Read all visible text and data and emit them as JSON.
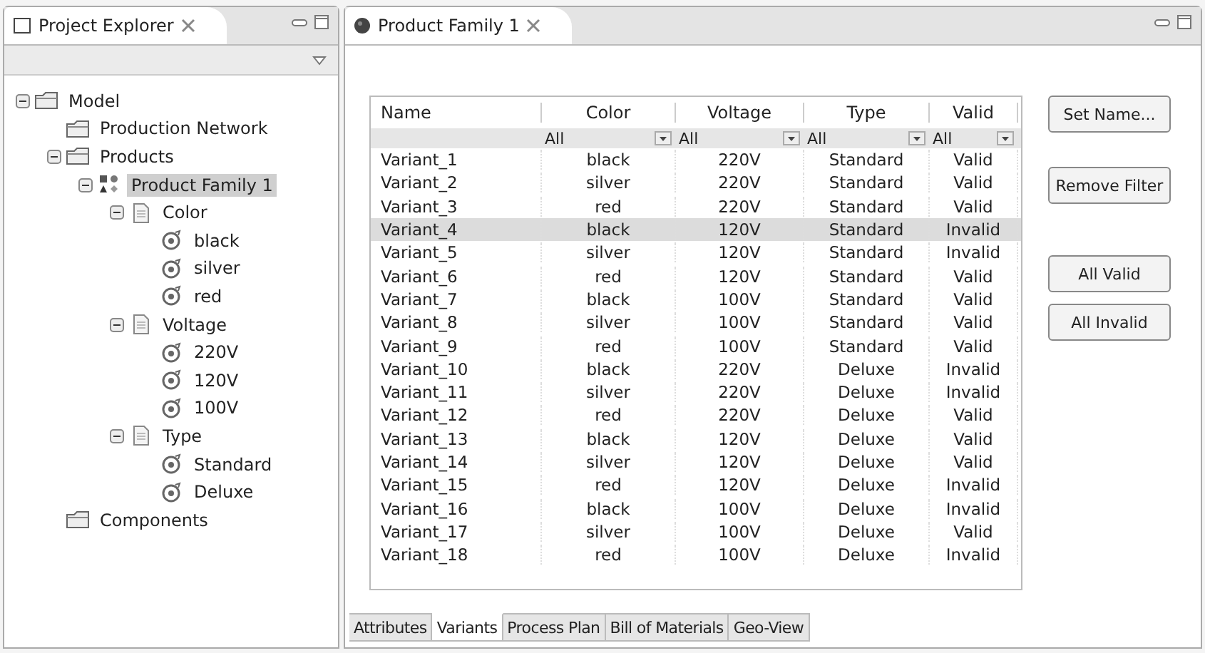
{
  "explorer": {
    "title": "Project Explorer",
    "tree": [
      {
        "label": "Model",
        "kind": "folder",
        "expanded": true,
        "selected": false,
        "children": [
          {
            "label": "Production Network",
            "kind": "folder",
            "selected": false
          },
          {
            "label": "Products",
            "kind": "folder",
            "expanded": true,
            "selected": false,
            "children": [
              {
                "label": "Product Family 1",
                "kind": "family",
                "expanded": true,
                "selected": true,
                "children": [
                  {
                    "label": "Color",
                    "kind": "feature",
                    "expanded": true,
                    "selected": false,
                    "children": [
                      {
                        "label": "black",
                        "kind": "option",
                        "selected": false
                      },
                      {
                        "label": "silver",
                        "kind": "option",
                        "selected": false
                      },
                      {
                        "label": "red",
                        "kind": "option",
                        "selected": false
                      }
                    ]
                  },
                  {
                    "label": "Voltage",
                    "kind": "feature",
                    "expanded": true,
                    "selected": false,
                    "children": [
                      {
                        "label": "220V",
                        "kind": "option",
                        "selected": false
                      },
                      {
                        "label": "120V",
                        "kind": "option",
                        "selected": false
                      },
                      {
                        "label": "100V",
                        "kind": "option",
                        "selected": false
                      }
                    ]
                  },
                  {
                    "label": "Type",
                    "kind": "feature",
                    "expanded": true,
                    "selected": false,
                    "children": [
                      {
                        "label": "Standard",
                        "kind": "option",
                        "selected": false
                      },
                      {
                        "label": "Deluxe",
                        "kind": "option",
                        "selected": false
                      }
                    ]
                  }
                ]
              }
            ]
          },
          {
            "label": "Components",
            "kind": "folder",
            "selected": false
          }
        ]
      }
    ]
  },
  "editor": {
    "title": "Product Family 1",
    "table": {
      "columns": [
        "Name",
        "Color",
        "Voltage",
        "Type",
        "Valid"
      ],
      "filters": [
        "All",
        "All",
        "All",
        "All"
      ],
      "rows": [
        {
          "cells": [
            "Variant_1",
            "black",
            "220V",
            "Standard",
            "Valid"
          ],
          "selected": false
        },
        {
          "cells": [
            "Variant_2",
            "silver",
            "220V",
            "Standard",
            "Valid"
          ],
          "selected": false
        },
        {
          "cells": [
            "Variant_3",
            "red",
            "220V",
            "Standard",
            "Valid"
          ],
          "selected": false
        },
        {
          "cells": [
            "Variant_4",
            "black",
            "120V",
            "Standard",
            "Invalid"
          ],
          "selected": true
        },
        {
          "cells": [
            "Variant_5",
            "silver",
            "120V",
            "Standard",
            "Invalid"
          ],
          "selected": false
        },
        {
          "cells": [
            "Variant_6",
            "red",
            "120V",
            "Standard",
            "Valid"
          ],
          "selected": false
        },
        {
          "cells": [
            "Variant_7",
            "black",
            "100V",
            "Standard",
            "Valid"
          ],
          "selected": false
        },
        {
          "cells": [
            "Variant_8",
            "silver",
            "100V",
            "Standard",
            "Valid"
          ],
          "selected": false
        },
        {
          "cells": [
            "Variant_9",
            "red",
            "100V",
            "Standard",
            "Valid"
          ],
          "selected": false
        },
        {
          "cells": [
            "Variant_10",
            "black",
            "220V",
            "Deluxe",
            "Invalid"
          ],
          "selected": false
        },
        {
          "cells": [
            "Variant_11",
            "silver",
            "220V",
            "Deluxe",
            "Invalid"
          ],
          "selected": false
        },
        {
          "cells": [
            "Variant_12",
            "red",
            "220V",
            "Deluxe",
            "Valid"
          ],
          "selected": false
        },
        {
          "cells": [
            "Variant_13",
            "black",
            "120V",
            "Deluxe",
            "Valid"
          ],
          "selected": false
        },
        {
          "cells": [
            "Variant_14",
            "silver",
            "120V",
            "Deluxe",
            "Valid"
          ],
          "selected": false
        },
        {
          "cells": [
            "Variant_15",
            "red",
            "120V",
            "Deluxe",
            "Invalid"
          ],
          "selected": false
        },
        {
          "cells": [
            "Variant_16",
            "black",
            "100V",
            "Deluxe",
            "Invalid"
          ],
          "selected": false
        },
        {
          "cells": [
            "Variant_17",
            "silver",
            "100V",
            "Deluxe",
            "Valid"
          ],
          "selected": false
        },
        {
          "cells": [
            "Variant_18",
            "red",
            "100V",
            "Deluxe",
            "Invalid"
          ],
          "selected": false
        }
      ]
    },
    "buttons": [
      "Set Name...",
      "Remove Filter",
      "All Valid",
      "All Invalid"
    ],
    "tabs": [
      {
        "label": "Attributes",
        "selected": false
      },
      {
        "label": "Variants",
        "selected": true
      },
      {
        "label": "Process Plan",
        "selected": false
      },
      {
        "label": "Bill of Materials",
        "selected": false
      },
      {
        "label": "Geo-View",
        "selected": false
      }
    ]
  }
}
